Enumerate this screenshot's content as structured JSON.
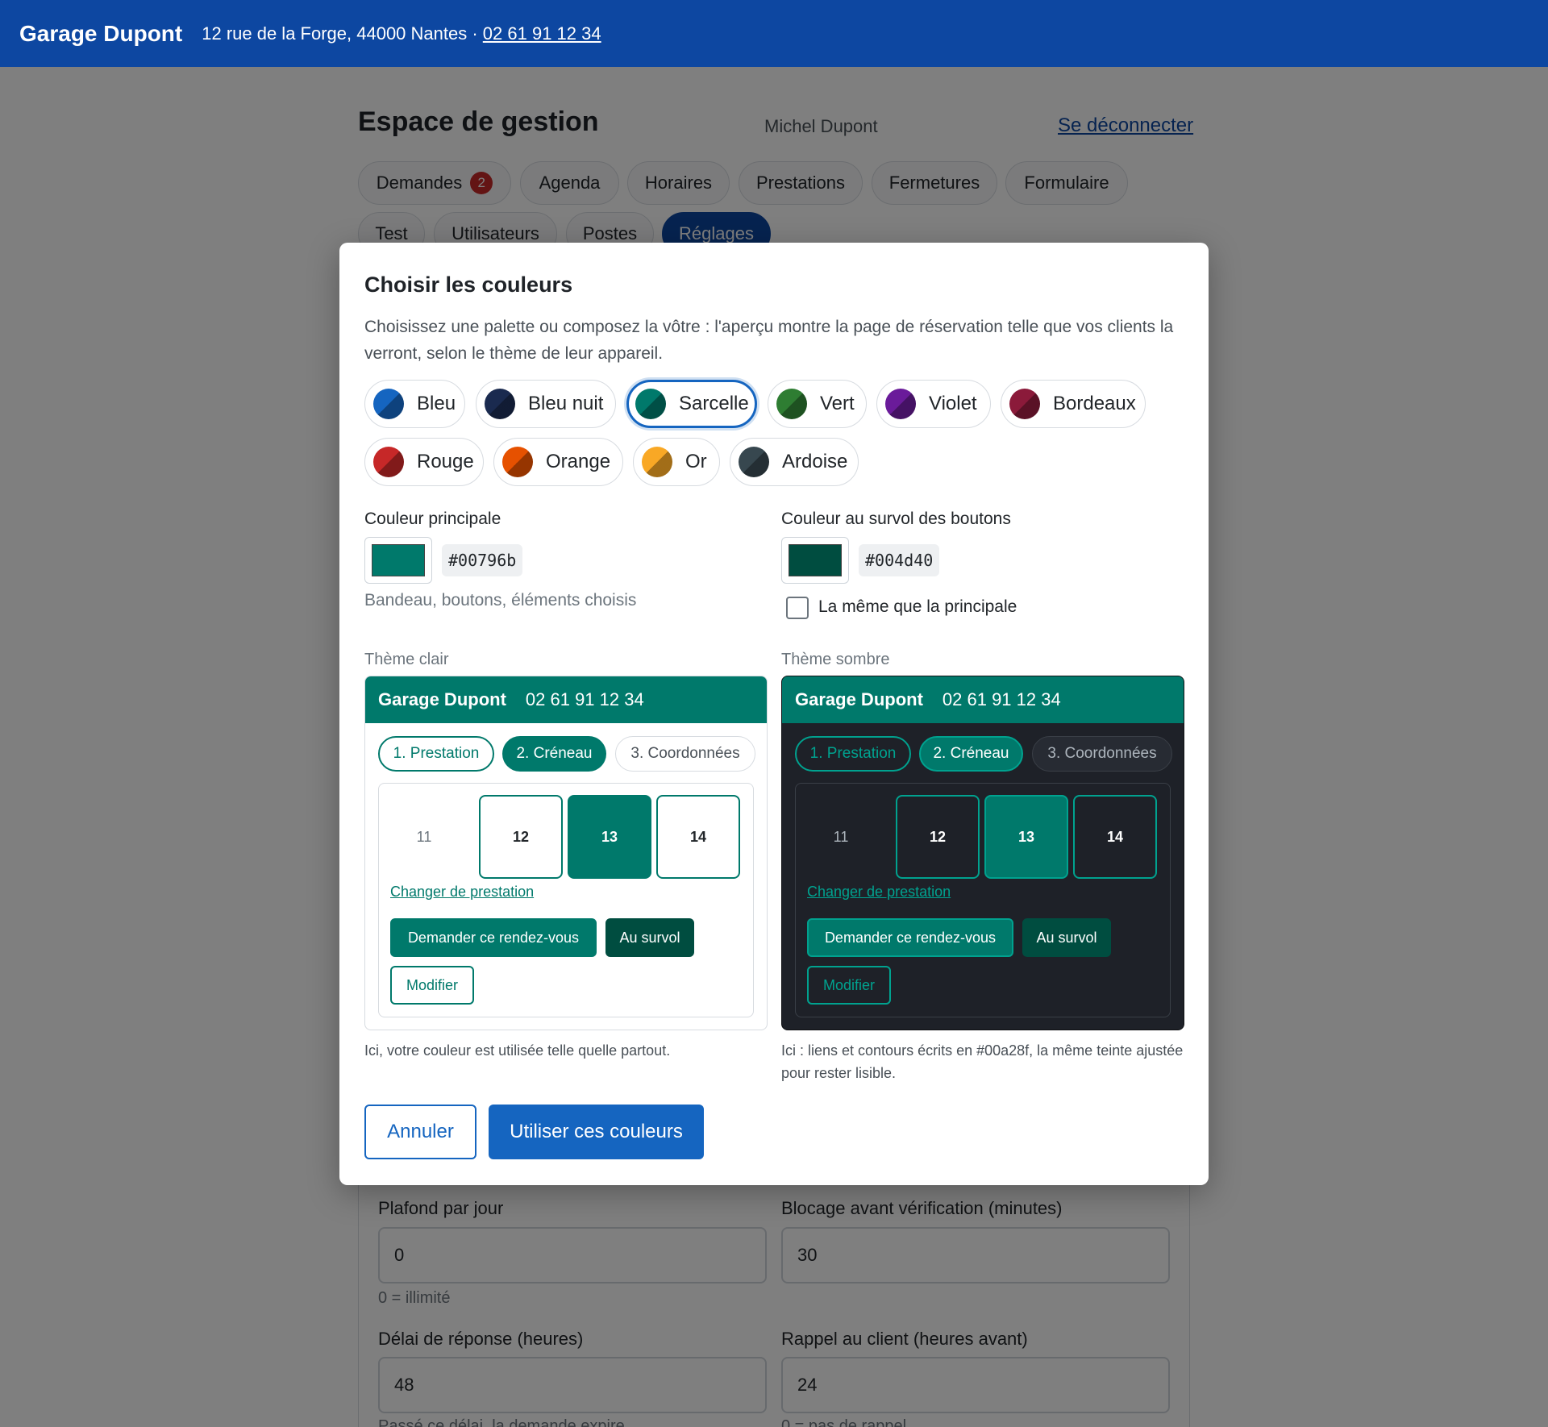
{
  "header": {
    "brand": "Garage Dupont",
    "address": "12 rue de la Forge, 44000 Nantes · ",
    "phone": "02 61 91 12 34"
  },
  "page": {
    "title": "Espace de gestion",
    "user": "Michel Dupont",
    "logout": "Se déconnecter",
    "tabs": [
      {
        "label": "Demandes",
        "badge": "2"
      },
      {
        "label": "Agenda"
      },
      {
        "label": "Horaires"
      },
      {
        "label": "Prestations"
      },
      {
        "label": "Fermetures"
      },
      {
        "label": "Formulaire"
      },
      {
        "label": "Test"
      },
      {
        "label": "Utilisateurs"
      },
      {
        "label": "Postes"
      },
      {
        "label": "Réglages",
        "active": true
      }
    ],
    "settings": {
      "fields": [
        {
          "label": "Plafond par jour",
          "value": "0",
          "help": "0 = illimité"
        },
        {
          "label": "Blocage avant vérification (minutes)",
          "value": "30",
          "help": ""
        },
        {
          "label": "Délai de réponse (heures)",
          "value": "48",
          "help": "Passé ce délai, la demande expire"
        },
        {
          "label": "Rappel au client (heures avant)",
          "value": "24",
          "help": "0 = pas de rappel"
        }
      ]
    }
  },
  "modal": {
    "title": "Choisir les couleurs",
    "description": "Choisissez une palette ou composez la vôtre : l'aperçu montre la page de réservation telle que vos clients la verront, selon le thème de leur appareil.",
    "palettes": [
      {
        "label": "Bleu",
        "color": "#1565c0",
        "icon": "swatch-icon"
      },
      {
        "label": "Bleu nuit",
        "color": "#1a2a4f",
        "icon": "swatch-icon"
      },
      {
        "label": "Sarcelle",
        "color": "#00796b",
        "icon": "swatch-icon",
        "selected": true
      },
      {
        "label": "Vert",
        "color": "#2e7d32",
        "icon": "swatch-icon"
      },
      {
        "label": "Violet",
        "color": "#6a1b9a",
        "icon": "swatch-icon"
      },
      {
        "label": "Bordeaux",
        "color": "#8b1a3a",
        "icon": "swatch-icon"
      },
      {
        "label": "Rouge",
        "color": "#c62828",
        "icon": "swatch-icon"
      },
      {
        "label": "Orange",
        "color": "#e65100",
        "icon": "swatch-icon"
      },
      {
        "label": "Or",
        "color": "#f9a825",
        "icon": "swatch-icon"
      },
      {
        "label": "Ardoise",
        "color": "#37474f",
        "icon": "swatch-icon"
      }
    ],
    "primary": {
      "label": "Couleur principale",
      "hex": "#00796b",
      "help": "Bandeau, boutons, éléments choisis"
    },
    "hover": {
      "label": "Couleur au survol des boutons",
      "hex": "#004d40",
      "same_label": "La même que la principale",
      "same_checked": false
    },
    "preview": {
      "brand": "Garage Dupont",
      "phone": "02 61 91 12 34",
      "steps": [
        "1. Prestation",
        "2. Créneau",
        "3. Coordonnées"
      ],
      "slots": [
        "11",
        "12",
        "13",
        "14"
      ],
      "selected_slot": "13",
      "link": "Changer de prestation",
      "request_button": "Demander ce rendez-vous",
      "hover_button": "Au survol",
      "modify_button": "Modifier",
      "light": {
        "label": "Thème clair",
        "caption": "Ici, votre couleur est utilisée telle quelle partout."
      },
      "dark": {
        "label": "Thème sombre",
        "caption": "Ici : liens et contours écrits en #00a28f, la même teinte ajustée pour rester lisible.",
        "accent": "#00a28f"
      }
    },
    "buttons": {
      "cancel": "Annuler",
      "apply": "Utiliser ces couleurs"
    }
  }
}
